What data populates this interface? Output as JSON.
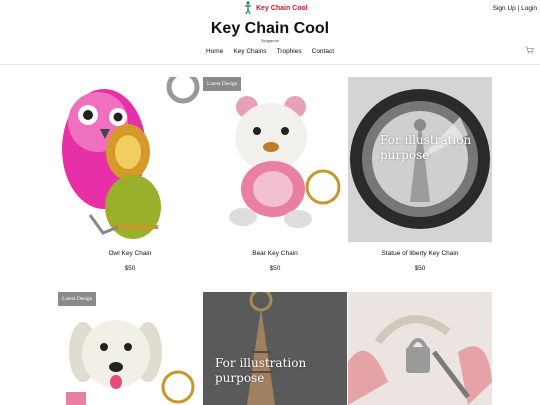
{
  "brand": {
    "logo_text": "Key Chain Cool",
    "title": "Key Chain Cool",
    "tagline": "Singapore"
  },
  "account": {
    "signup": "Sign Up",
    "separator": "|",
    "login": "Login"
  },
  "nav": {
    "items": [
      "Home",
      "Key Chains",
      "Trophies",
      "Contact"
    ]
  },
  "badge": {
    "latest": "Latest Design"
  },
  "overlay": {
    "text": "For illustration purpose"
  },
  "products": [
    {
      "name": "Owl Key Chain",
      "price": "$50"
    },
    {
      "name": "Bear Key Chain",
      "price": "$50"
    },
    {
      "name": "Statue of liberty Key Chain",
      "price": "$50"
    }
  ],
  "colors": {
    "brand_red": "#c0182f",
    "badge_gray": "#8a8a8a",
    "logo_green": "#1c8a5a"
  },
  "icons": {
    "logo": "figure-logo-icon",
    "cart": "cart-icon"
  }
}
